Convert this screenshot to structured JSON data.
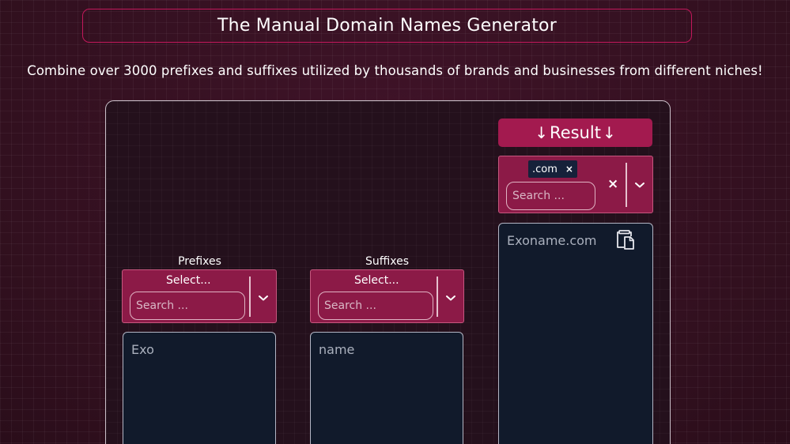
{
  "header": {
    "title": "The Manual Domain Names Generator",
    "subtitle": "Combine over 3000 prefixes and suffixes utilized by thousands of brands and businesses from different niches!"
  },
  "result": {
    "button_label": "Result",
    "arrow_left": "↓",
    "arrow_right": "↓",
    "selected_tag": ".com",
    "tag_remove": "×",
    "clear": "×",
    "search_placeholder": "Search ...",
    "output_value": "Exoname.com",
    "copy_icon": "clipboard-icon"
  },
  "prefixes": {
    "label": "Prefixes",
    "select_placeholder": "Select...",
    "search_placeholder": "Search ...",
    "text_value": "Exo"
  },
  "suffixes": {
    "label": "Suffixes",
    "select_placeholder": "Select...",
    "search_placeholder": "Search ...",
    "text_value": "name"
  },
  "colors": {
    "accent": "#a31a4f",
    "select_bg": "#8c1a47",
    "page_bg": "#3a1124",
    "textbox_bg": "#111a2b"
  }
}
